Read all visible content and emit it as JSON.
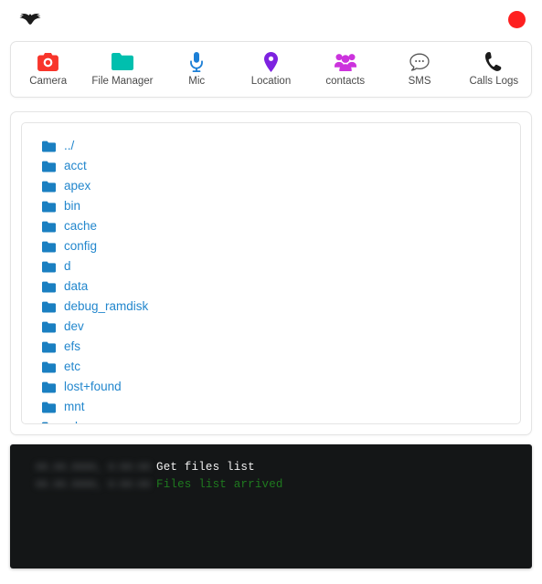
{
  "app": {
    "logo_icon": "bat-logo-icon",
    "status_indicator": {
      "icon": "record-dot-icon",
      "color": "#fe2020",
      "label": "Recording"
    }
  },
  "nav": {
    "items": [
      {
        "label": "Camera",
        "icon": "camera-icon",
        "color": "#f8352b"
      },
      {
        "label": "File Manager",
        "icon": "folder-icon",
        "color": "#00bfae"
      },
      {
        "label": "Mic",
        "icon": "microphone-icon",
        "color": "#1c7fd6"
      },
      {
        "label": "Location",
        "icon": "map-pin-icon",
        "color": "#7d22e0"
      },
      {
        "label": "contacts",
        "icon": "contacts-icon",
        "color": "#cc33dd"
      },
      {
        "label": "SMS",
        "icon": "sms-bubble-icon",
        "color": "#555555"
      },
      {
        "label": "Calls Logs",
        "icon": "phone-icon",
        "color": "#1b1b1b"
      }
    ]
  },
  "file_browser": {
    "link_color": "#2387cd",
    "folder_icon_color": "#1a7fc1",
    "entries": [
      {
        "name": "../",
        "icon": "folder-icon"
      },
      {
        "name": "acct",
        "icon": "folder-icon"
      },
      {
        "name": "apex",
        "icon": "folder-icon"
      },
      {
        "name": "bin",
        "icon": "folder-icon"
      },
      {
        "name": "cache",
        "icon": "folder-icon"
      },
      {
        "name": "config",
        "icon": "folder-icon"
      },
      {
        "name": "d",
        "icon": "folder-icon"
      },
      {
        "name": "data",
        "icon": "folder-icon"
      },
      {
        "name": "debug_ramdisk",
        "icon": "folder-icon"
      },
      {
        "name": "dev",
        "icon": "folder-icon"
      },
      {
        "name": "efs",
        "icon": "folder-icon"
      },
      {
        "name": "etc",
        "icon": "folder-icon"
      },
      {
        "name": "lost+found",
        "icon": "folder-icon"
      },
      {
        "name": "mnt",
        "icon": "folder-icon"
      },
      {
        "name": "odm",
        "icon": "folder-icon"
      }
    ]
  },
  "console": {
    "background": "#141617",
    "lines": [
      {
        "time": "00.00.0000, 0:00:00",
        "message": "Get files list",
        "type": "command"
      },
      {
        "time": "00.00.0000, 0:00:00",
        "message": "Files list arrived",
        "type": "success"
      }
    ]
  }
}
